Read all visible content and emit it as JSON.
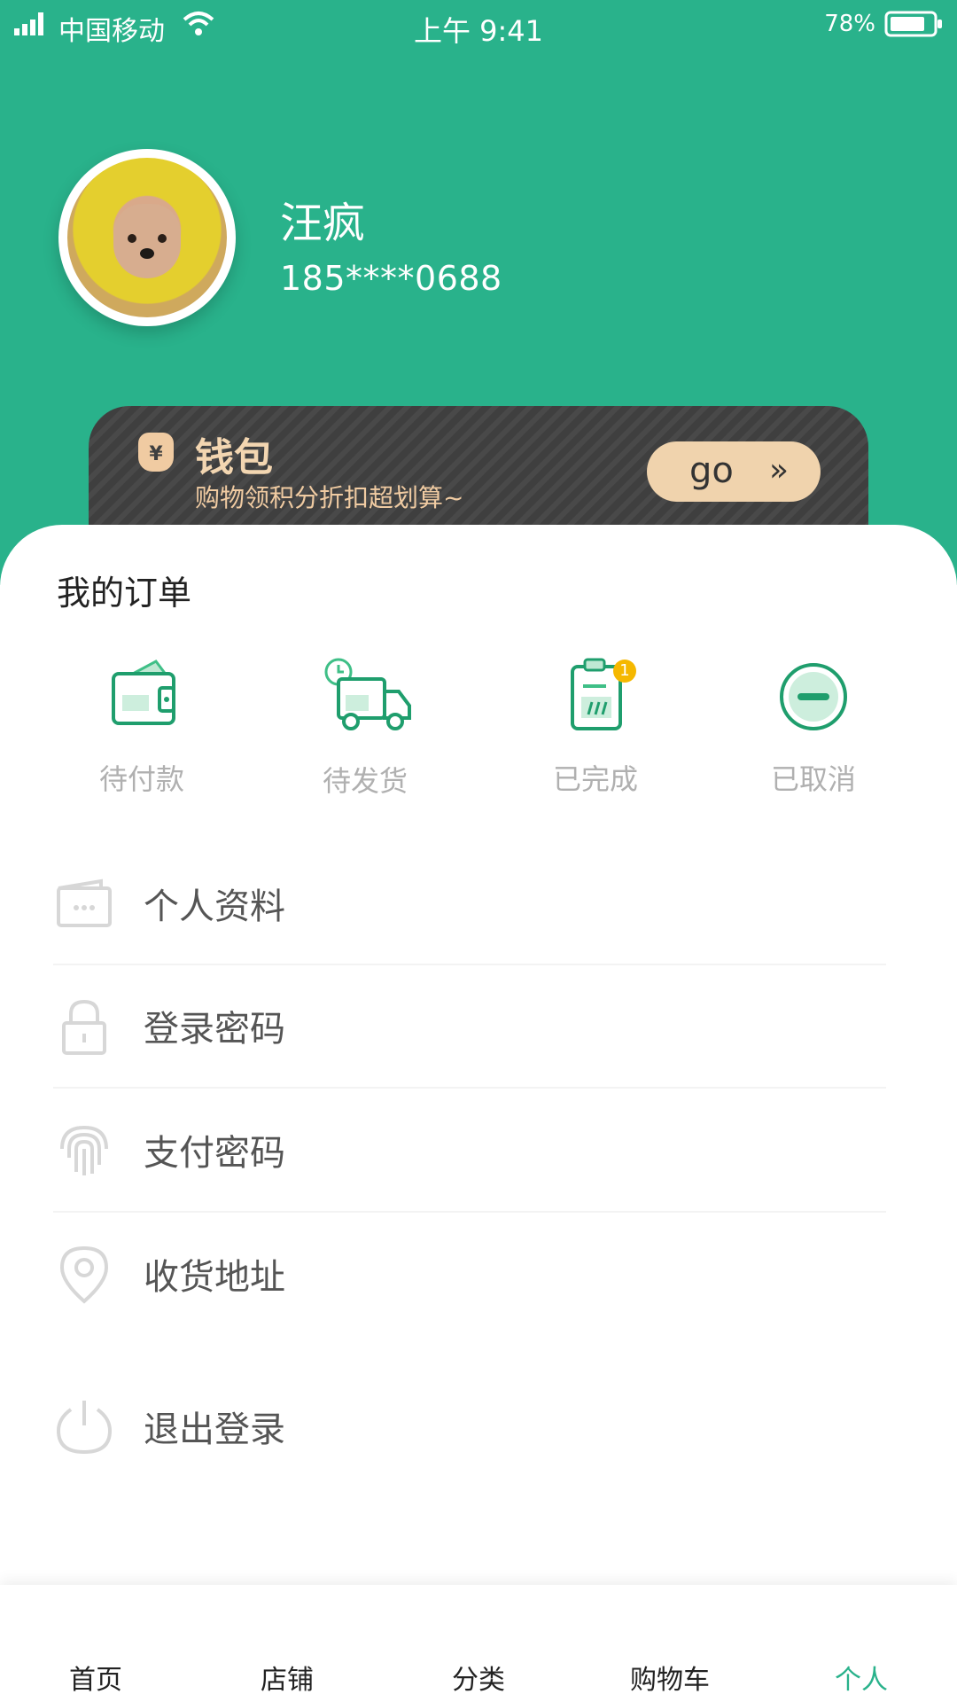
{
  "status_bar": {
    "carrier": "中国移动",
    "time": "上午 9:41",
    "battery_percent": "78%"
  },
  "profile": {
    "name": "汪疯",
    "phone": "185****0688"
  },
  "wallet": {
    "title": "钱包",
    "subtitle": "购物领积分折扣超划算~",
    "button_label": "go",
    "button_icon": "double-chevron-right-icon"
  },
  "orders": {
    "title": "我的订单",
    "items": [
      {
        "label": "待付款",
        "icon": "wallet-icon"
      },
      {
        "label": "待发货",
        "icon": "delivery-truck-icon"
      },
      {
        "label": "已完成",
        "icon": "clipboard-icon",
        "badge": "1"
      },
      {
        "label": "已取消",
        "icon": "minus-circle-icon"
      }
    ]
  },
  "menu": {
    "items": [
      {
        "label": "个人资料",
        "icon": "profile-card-icon"
      },
      {
        "label": "登录密码",
        "icon": "lock-icon"
      },
      {
        "label": "支付密码",
        "icon": "fingerprint-icon"
      },
      {
        "label": "收货地址",
        "icon": "location-pin-icon"
      },
      {
        "label": "退出登录",
        "icon": "power-icon"
      }
    ]
  },
  "tab_bar": {
    "items": [
      {
        "label": "首页",
        "icon": "home-icon"
      },
      {
        "label": "店铺",
        "icon": "store-icon"
      },
      {
        "label": "分类",
        "icon": "category-icon"
      },
      {
        "label": "购物车",
        "icon": "cart-icon"
      },
      {
        "label": "个人",
        "icon": "user-icon",
        "active": true
      }
    ]
  },
  "colors": {
    "brand": "#29b28b",
    "wallet_bg": "#3f3f3f",
    "wallet_text": "#f0cba2",
    "badge": "#f5b800"
  }
}
